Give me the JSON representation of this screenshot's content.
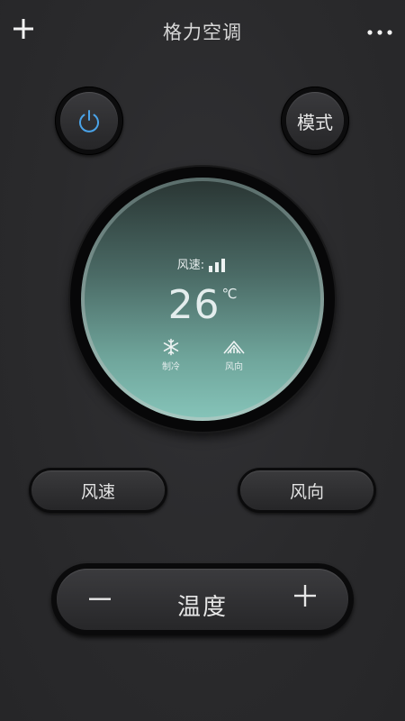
{
  "header": {
    "title": "格力空调"
  },
  "controls": {
    "mode_label": "模式",
    "speed_label": "风速",
    "direction_label": "风向",
    "temp_label": "温度"
  },
  "display": {
    "wind_speed_label": "风速:",
    "temperature": "26",
    "temperature_unit": "℃",
    "mode_status": "制冷",
    "direction_status": "风向"
  },
  "icons": {
    "add": "plus-icon",
    "more": "more-dots-icon",
    "power": "power-icon",
    "speed_bars": "signal-bars-icon",
    "cooling": "snowflake-icon",
    "direction": "wind-direction-icon",
    "minus": "minus-icon",
    "plus": "plus-icon"
  },
  "colors": {
    "power_accent": "#4aa3e8",
    "screen_bottom": "#85c3b8",
    "screen_top": "#2a3634"
  }
}
